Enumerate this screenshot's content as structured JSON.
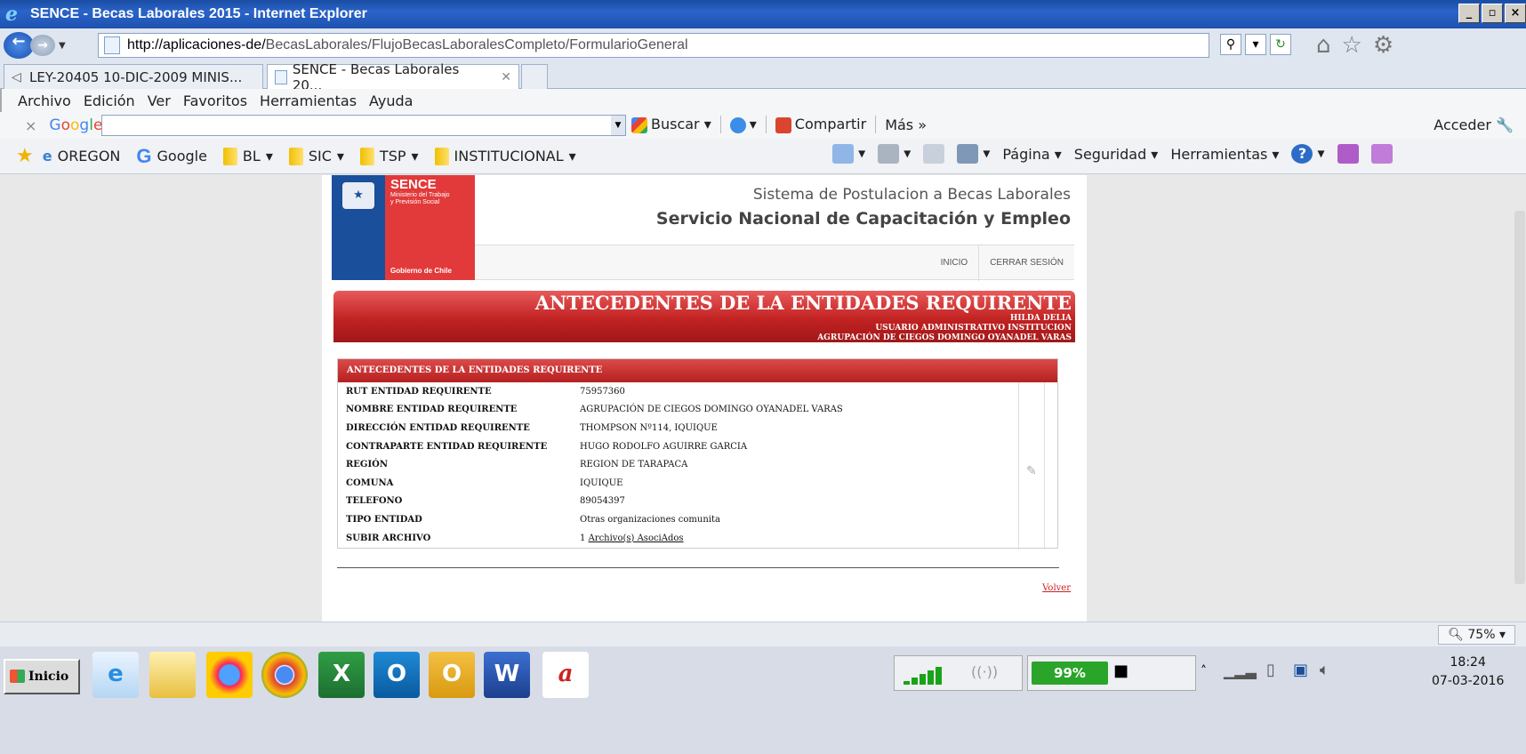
{
  "window": {
    "title": "SENCE - Becas Laborales 2015 - Internet Explorer"
  },
  "address": {
    "url_bold": "http://aplicaciones-de/",
    "url_rest": "BecasLaborales/FlujoBecasLaboralesCompleto/FormularioGeneral",
    "url_prefix": "http://aplicaciones-de"
  },
  "tabs": [
    {
      "label": "LEY-20405 10-DIC-2009 MINIS..."
    },
    {
      "label": "SENCE - Becas Laborales 20..."
    }
  ],
  "menu": [
    "Archivo",
    "Edición",
    "Ver",
    "Favoritos",
    "Herramientas",
    "Ayuda"
  ],
  "google_toolbar": {
    "logo": "Google",
    "buscar": "Buscar",
    "compartir": "Compartir",
    "mas": "Más »",
    "acceder": "Acceder"
  },
  "favorites": [
    "OREGON",
    "Google",
    "BL",
    "SIC",
    "TSP",
    "INSTITUCIONAL"
  ],
  "command_bar": {
    "pagina": "Página",
    "seguridad": "Seguridad",
    "herramientas": "Herramientas"
  },
  "site": {
    "logo_title": "SENCE",
    "logo_sub1": "Ministerio del Trabajo",
    "logo_sub2": "y Previsión Social",
    "logo_gov": "Gobierno de Chile",
    "system_title": "Sistema de Postulacion a Becas Laborales",
    "service_title": "Servicio Nacional de Capacitación y Empleo",
    "nav_inicio": "INICIO",
    "nav_cerrar": "CERRAR SESIÓN",
    "banner_title": "ANTECEDENTES DE LA ENTIDADES REQUIRENTE",
    "banner_user": "HILDA DELIA",
    "banner_role": "USUARIO ADMINISTRATIVO INSTITUCION",
    "banner_org": "AGRUPACIÓN DE CIEGOS DOMINGO OYANADEL VARAS",
    "panel_title": "ANTECEDENTES DE LA ENTIDADES REQUIRENTE",
    "rows": [
      {
        "label": "RUT ENTIDAD REQUIRENTE",
        "value": "75957360"
      },
      {
        "label": "NOMBRE ENTIDAD REQUIRENTE",
        "value": "AGRUPACIÓN DE CIEGOS DOMINGO OYANADEL VARAS"
      },
      {
        "label": "DIRECCIÓN ENTIDAD REQUIRENTE",
        "value": "THOMPSON Nº114, IQUIQUE"
      },
      {
        "label": "CONTRAPARTE ENTIDAD REQUIRENTE",
        "value": "HUGO RODOLFO AGUIRRE GARCIA"
      },
      {
        "label": "REGIÓN",
        "value": "REGION DE TARAPACA"
      },
      {
        "label": "COMUNA",
        "value": "IQUIQUE"
      },
      {
        "label": "TELEFONO",
        "value": "89054397"
      },
      {
        "label": "TIPO ENTIDAD",
        "value": "Otras organizaciones comunita"
      },
      {
        "label": "SUBIR ARCHIVO",
        "value_prefix": "1",
        "value_link": "Archivo(s) AsociAdos"
      }
    ],
    "volver": "Volver"
  },
  "status": {
    "zoom": "75%"
  },
  "taskbar": {
    "start": "Inicio",
    "battery": "99%",
    "time": "18:24",
    "date": "07-03-2016"
  },
  "colors": {
    "brand_red": "#c22222",
    "brand_blue": "#1a4f9b",
    "arrow_fill": "#ffff00",
    "arrow_stroke": "#2db82d"
  }
}
